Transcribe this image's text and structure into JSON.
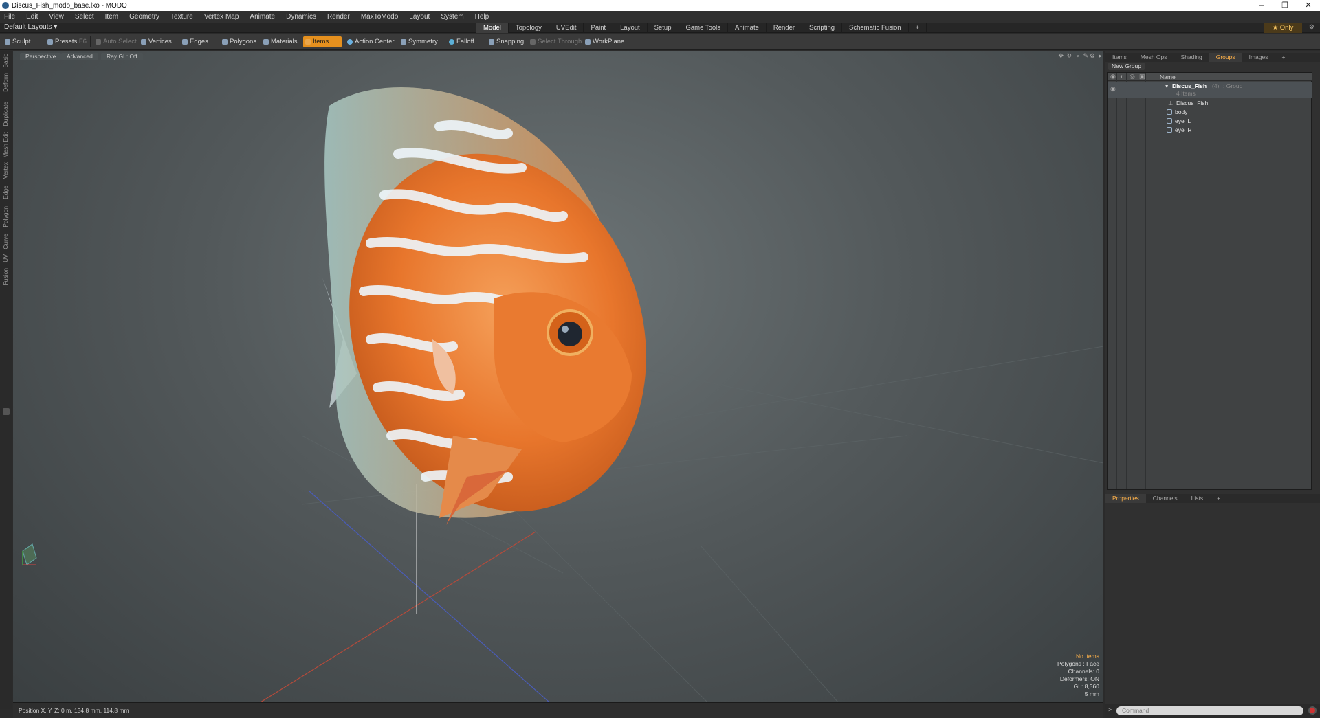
{
  "window": {
    "title": "Discus_Fish_modo_base.lxo - MODO",
    "controls": [
      "–",
      "❐",
      "✕"
    ]
  },
  "menu": [
    "File",
    "Edit",
    "View",
    "Select",
    "Item",
    "Geometry",
    "Texture",
    "Vertex Map",
    "Animate",
    "Dynamics",
    "Render",
    "MaxToModo",
    "Layout",
    "System",
    "Help"
  ],
  "layouts": {
    "dropdown": "Default Layouts ▾",
    "tabs": [
      "Model",
      "Topology",
      "UVEdit",
      "Paint",
      "Layout",
      "Setup",
      "Game Tools",
      "Animate",
      "Render",
      "Scripting",
      "Schematic Fusion",
      "+"
    ],
    "active": "Model",
    "only": "★ Only"
  },
  "toolbar": {
    "sculpt": "Sculpt",
    "presets": "Presets",
    "presets_key": "F6",
    "auto_select": "Auto Select",
    "vertices": "Vertices",
    "edges": "Edges",
    "polygons": "Polygons",
    "materials": "Materials",
    "items": "Items",
    "action_center": "Action Center",
    "symmetry": "Symmetry",
    "falloff": "Falloff",
    "snapping": "Snapping",
    "select_through": "Select Through",
    "workplane": "WorkPlane"
  },
  "left_tabs": [
    "Basic",
    "Deform",
    "Duplicate",
    "Mesh Edit",
    "Vertex",
    "Edge",
    "Polygon",
    "Curve",
    "UV",
    "Fusion"
  ],
  "viewport": {
    "view": "Perspective",
    "mode": "Advanced",
    "raygl": "Ray GL: Off",
    "info": {
      "no_items": "No Items",
      "polygons": "Polygons : Face",
      "channels": "Channels: 0",
      "deformers": "Deformers: ON",
      "gl": "GL: 8,360",
      "scale": "5 mm"
    }
  },
  "status": {
    "position": "Position X, Y, Z:  0 m, 134.8 mm, 114.8 mm"
  },
  "right_panel": {
    "tabs": [
      "Items",
      "Mesh Ops",
      "Shading",
      "Groups",
      "Images",
      "+"
    ],
    "active_tab": "Groups",
    "new_group": "New Group",
    "column_name": "Name",
    "group": {
      "name": "Discus_Fish",
      "count": "(4)",
      "type": ": Group",
      "sub": "4 Items"
    },
    "items": [
      "Discus_Fish",
      "body",
      "eye_L",
      "eye_R"
    ],
    "prop_tabs": [
      "Properties",
      "Channels",
      "Lists",
      "+"
    ],
    "prop_active": "Properties",
    "command_placeholder": "Command"
  },
  "colors": {
    "accent": "#e5901e",
    "active_tab_text": "#ffb24a",
    "viewport_bg": "#53595b"
  }
}
